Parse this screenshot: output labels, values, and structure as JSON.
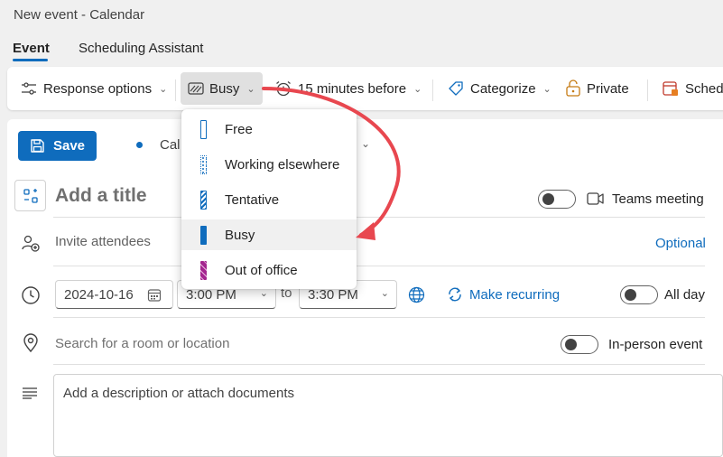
{
  "window": {
    "title": "New event - Calendar"
  },
  "tabs": [
    {
      "label": "Event"
    },
    {
      "label": "Scheduling Assistant"
    }
  ],
  "toolbar": {
    "response_options": "Response options",
    "show_as": "Busy",
    "reminder": "15 minutes before",
    "categorize": "Categorize",
    "private": "Private",
    "schedule": "Schedu"
  },
  "save_label": "Save",
  "calendar_label": "Cal",
  "title_placeholder": "Add a title",
  "teams_meeting": "Teams meeting",
  "invite_attendees": "Invite attendees",
  "optional": "Optional",
  "date": "2024-10-16",
  "start_time": "3:00 PM",
  "to": "to",
  "end_time": "3:30 PM",
  "make_recurring": "Make recurring",
  "all_day": "All day",
  "location_placeholder": "Search for a room or location",
  "in_person": "In-person event",
  "description_placeholder": "Add a description or attach documents",
  "show_as_menu": [
    {
      "label": "Free",
      "color": "#0f6cbd",
      "style": "outline"
    },
    {
      "label": "Working elsewhere",
      "color": "#0f6cbd",
      "style": "dotted"
    },
    {
      "label": "Tentative",
      "color": "#0f6cbd",
      "style": "striped"
    },
    {
      "label": "Busy",
      "color": "#0f6cbd",
      "style": "solid"
    },
    {
      "label": "Out of office",
      "color": "#a4268f",
      "style": "pattern"
    }
  ],
  "colors": {
    "accent": "#0f6cbd",
    "arrow": "#e8474f"
  }
}
